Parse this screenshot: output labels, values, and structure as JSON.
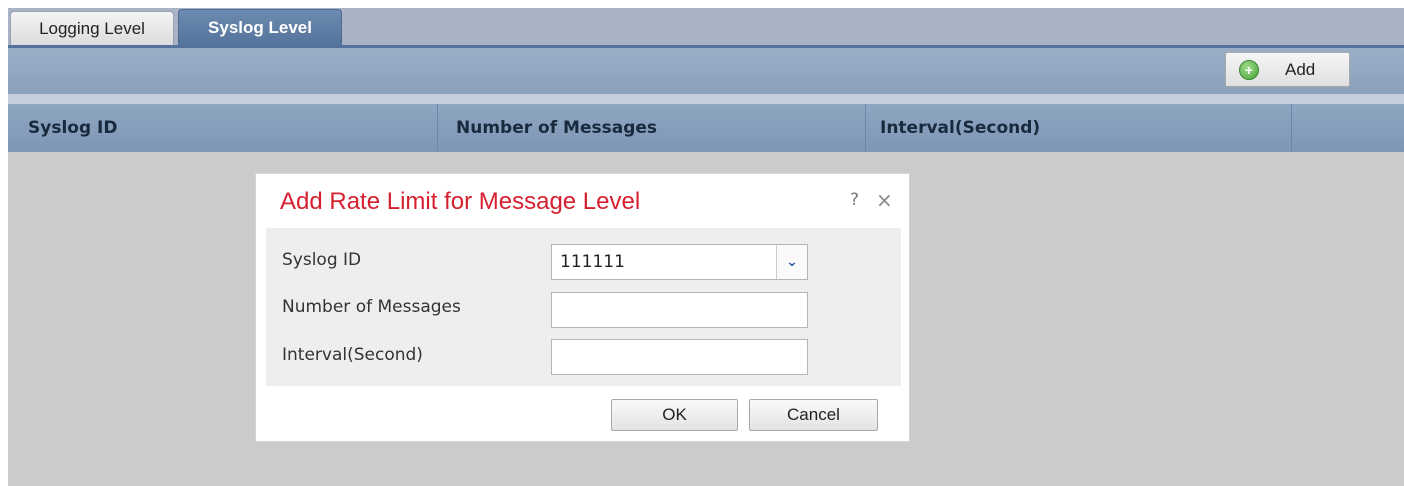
{
  "tabs": [
    {
      "label": "Logging Level",
      "active": false
    },
    {
      "label": "Syslog Level",
      "active": true
    }
  ],
  "toolbar": {
    "add_label": "Add",
    "add_icon": "add-circle-icon"
  },
  "table": {
    "columns": [
      "Syslog ID",
      "Number of Messages",
      "Interval(Second)",
      ""
    ]
  },
  "dialog": {
    "title": "Add Rate Limit for Message Level",
    "help_glyph": "?",
    "close_glyph": "×",
    "fields": [
      {
        "label": "Syslog ID",
        "value": "111111",
        "type": "combo"
      },
      {
        "label": "Number of Messages",
        "value": "",
        "type": "text"
      },
      {
        "label": "Interval(Second)",
        "value": "",
        "type": "text"
      }
    ],
    "ok_label": "OK",
    "cancel_label": "Cancel"
  },
  "colors": {
    "title": "#d62030",
    "active_tab": "#55749c",
    "table_header": "#8fa6c2"
  }
}
